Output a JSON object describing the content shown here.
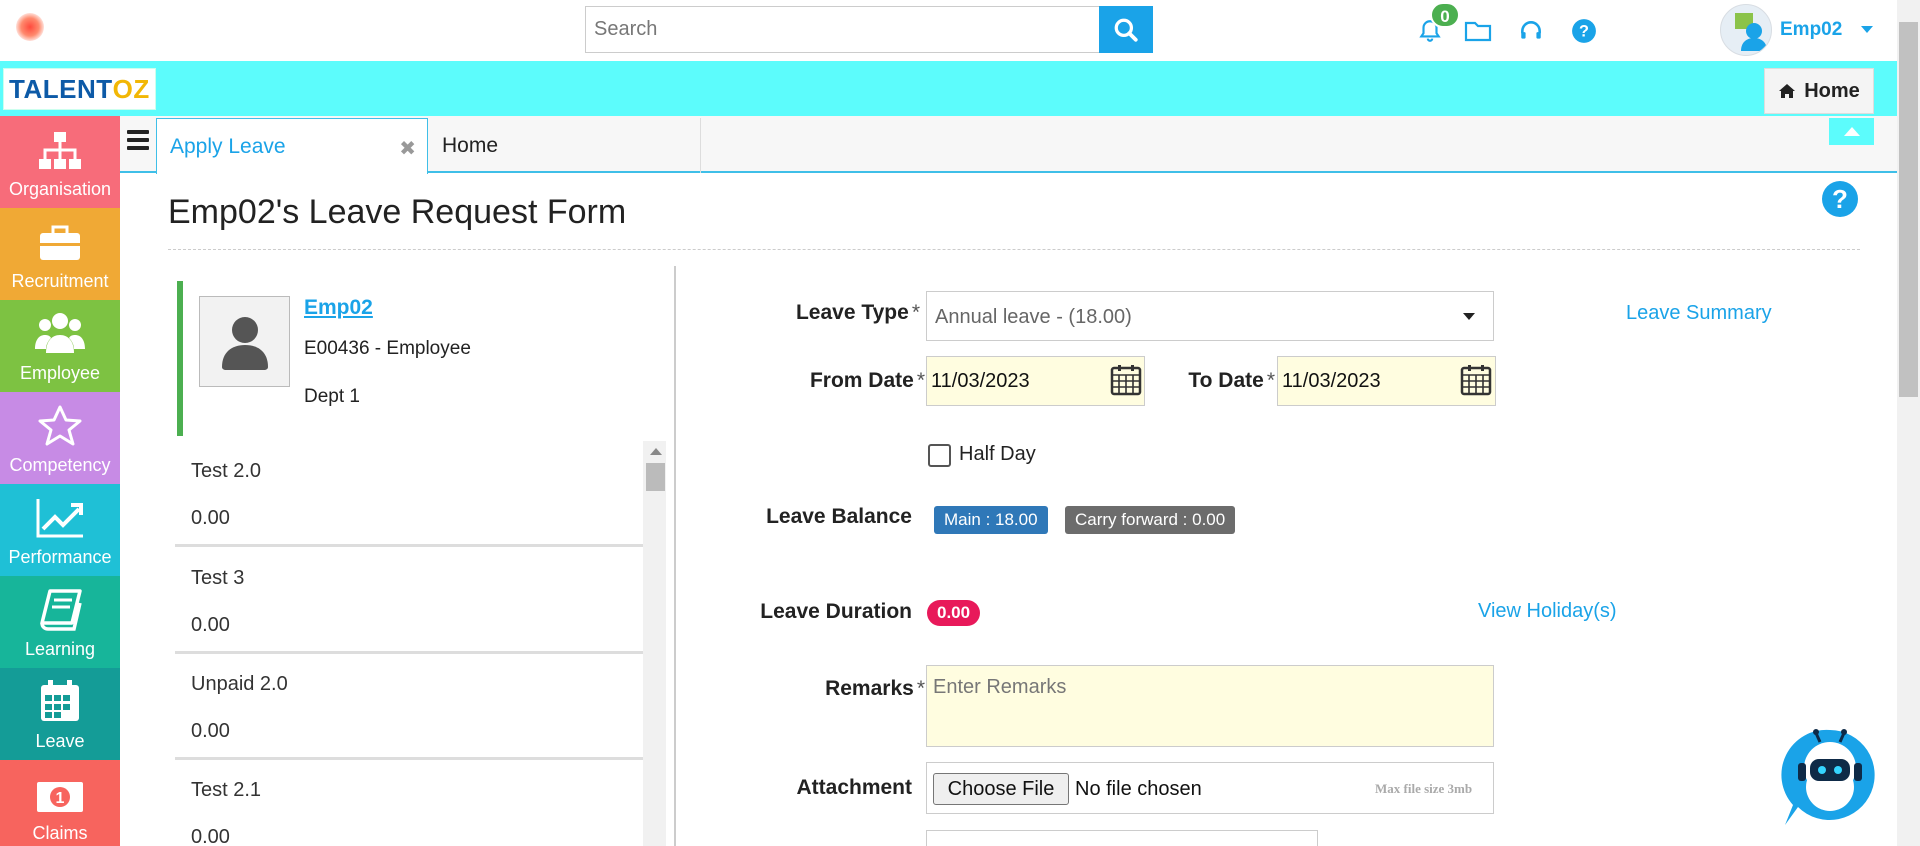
{
  "header": {
    "search_placeholder": "Search",
    "notification_count": "0",
    "user_name": "Emp02",
    "home_label": "Home",
    "brand_prefix": "TALENT",
    "brand_suffix": "OZ"
  },
  "sidebar": {
    "items": [
      {
        "label": "Organisation",
        "color": "#f76c7a",
        "icon": "org-chart-icon"
      },
      {
        "label": "Recruitment",
        "color": "#f0a935",
        "icon": "briefcase-icon"
      },
      {
        "label": "Employee",
        "color": "#7dc242",
        "icon": "group-icon"
      },
      {
        "label": "Competency",
        "color": "#c78be5",
        "icon": "star-icon"
      },
      {
        "label": "Performance",
        "color": "#1fc0d6",
        "icon": "chart-line-icon"
      },
      {
        "label": "Learning",
        "color": "#17b59a",
        "icon": "book-icon"
      },
      {
        "label": "Leave",
        "color": "#149c97",
        "icon": "calendar-icon"
      },
      {
        "label": "Claims",
        "color": "#f7645e",
        "icon": "money-icon"
      }
    ]
  },
  "tabs": [
    {
      "label": "Apply Leave",
      "active": true
    },
    {
      "label": "Home",
      "active": false
    }
  ],
  "page": {
    "title": "Emp02's Leave Request Form"
  },
  "employee": {
    "name": "Emp02",
    "code": "E00436 - Employee",
    "dept": "Dept 1"
  },
  "balances": [
    {
      "name": "Test 2.0",
      "value": "0.00"
    },
    {
      "name": "Test 3",
      "value": "0.00"
    },
    {
      "name": "Unpaid 2.0",
      "value": "0.00"
    },
    {
      "name": "Test 2.1",
      "value": "0.00"
    }
  ],
  "form": {
    "leave_type_label": "Leave Type",
    "leave_type_value": "Annual leave - (18.00)",
    "from_label": "From Date",
    "from_value": "11/03/2023",
    "to_label": "To Date",
    "to_value": "11/03/2023",
    "leave_summary_link": "Leave Summary",
    "half_day_label": "Half Day",
    "balance_label": "Leave Balance",
    "balance_main": "Main : 18.00",
    "balance_cf": "Carry forward : 0.00",
    "duration_label": "Leave Duration",
    "duration_value": "0.00",
    "view_holiday_link": "View Holiday(s)",
    "remarks_label": "Remarks",
    "remarks_placeholder": "Enter Remarks",
    "attachment_label": "Attachment",
    "choose_file": "Choose File",
    "no_file": "No file chosen",
    "max_size": "Max file size 3mb",
    "required_mark": "*"
  }
}
